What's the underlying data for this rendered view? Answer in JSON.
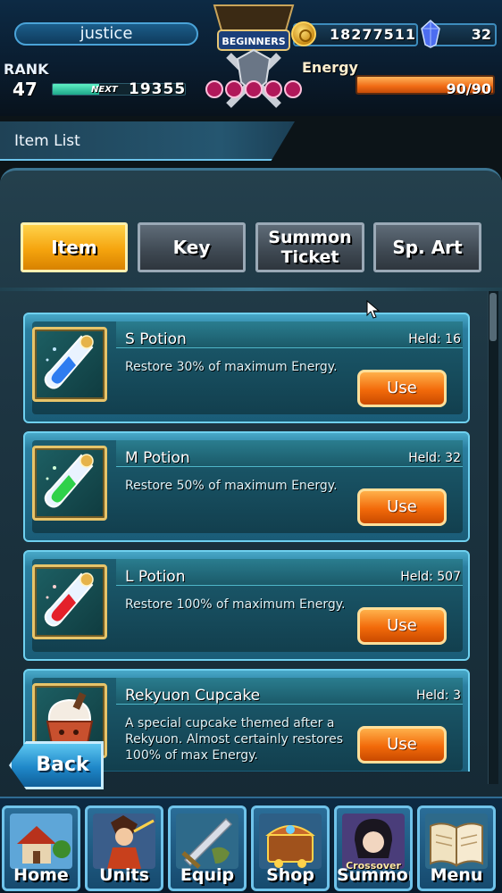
{
  "player": {
    "name": "justice",
    "rank_label": "RANK",
    "rank": "47",
    "next_label": "NEXT",
    "next_exp": "19355",
    "exp_progress": 0.35
  },
  "emblem": {
    "text": "BEGINNERS"
  },
  "currency": {
    "gold": "18277511",
    "gems": "32"
  },
  "energy": {
    "label": "Energy",
    "value": "90/90",
    "fraction": 1.0
  },
  "page_title": "Item List",
  "tabs": [
    {
      "label": "Item",
      "active": true
    },
    {
      "label": "Key",
      "active": false
    },
    {
      "label_line1": "Summon",
      "label_line2": "Ticket",
      "active": false
    },
    {
      "label": "Sp. Art",
      "active": false
    }
  ],
  "items": [
    {
      "name": "S Potion",
      "held": "Held: 16",
      "desc": "Restore 30% of maximum Energy.",
      "use_label": "Use",
      "icon": "blue-potion-icon",
      "color": "#2e7cf0"
    },
    {
      "name": "M Potion",
      "held": "Held: 32",
      "desc": "Restore 50% of maximum Energy.",
      "use_label": "Use",
      "icon": "green-potion-icon",
      "color": "#2fd14a"
    },
    {
      "name": "L Potion",
      "held": "Held: 507",
      "desc": "Restore 100% of maximum Energy.",
      "use_label": "Use",
      "icon": "red-potion-icon",
      "color": "#e4202a"
    },
    {
      "name": "Rekyuon Cupcake",
      "held": "Held: 3",
      "desc": "A special cupcake themed after a Rekyuon. Almost certainly restores 100% of max Energy.",
      "use_label": "Use",
      "icon": "cupcake-icon",
      "color": "#c8502e"
    }
  ],
  "back_label": "Back",
  "nav": [
    {
      "label": "Home",
      "icon": "home-icon"
    },
    {
      "label": "Units",
      "icon": "units-icon"
    },
    {
      "label": "Equip",
      "icon": "equip-icon"
    },
    {
      "label": "Shop",
      "icon": "shop-icon"
    },
    {
      "label": "Summon",
      "sub": "Crossover",
      "icon": "summon-icon"
    },
    {
      "label": "Menu",
      "icon": "menu-book-icon"
    }
  ]
}
